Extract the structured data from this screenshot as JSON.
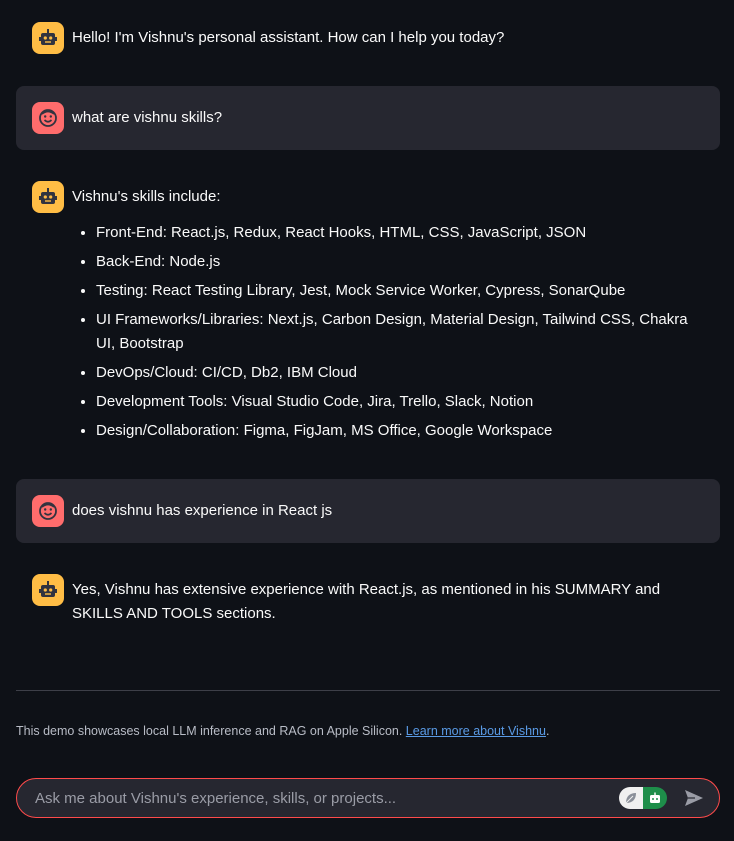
{
  "messages": [
    {
      "role": "assistant",
      "text": "Hello! I'm Vishnu's personal assistant. How can I help you today?"
    },
    {
      "role": "user",
      "text": "what are vishnu skills?"
    },
    {
      "role": "assistant",
      "text": "Vishnu's skills include:",
      "list": [
        "Front-End: React.js, Redux, React Hooks, HTML, CSS, JavaScript, JSON",
        "Back-End: Node.js",
        "Testing: React Testing Library, Jest, Mock Service Worker, Cypress, SonarQube",
        "UI Frameworks/Libraries: Next.js, Carbon Design, Material Design, Tailwind CSS, Chakra UI, Bootstrap",
        "DevOps/Cloud: CI/CD, Db2, IBM Cloud",
        "Development Tools: Visual Studio Code, Jira, Trello, Slack, Notion",
        "Design/Collaboration: Figma, FigJam, MS Office, Google Workspace"
      ]
    },
    {
      "role": "user",
      "text": "does vishnu has experience in React js"
    },
    {
      "role": "assistant",
      "text": "Yes, Vishnu has extensive experience with React.js, as mentioned in his SUMMARY and SKILLS AND TOOLS sections."
    }
  ],
  "footer": {
    "text": "This demo showcases local LLM inference and RAG on Apple Silicon. ",
    "link_text": "Learn more about Vishnu",
    "trailing": "."
  },
  "input": {
    "placeholder": "Ask me about Vishnu's experience, skills, or projects..."
  },
  "colors": {
    "background": "#0e1117",
    "user_bubble": "#262730",
    "bot_avatar": "#ffbd45",
    "user_avatar": "#ff6c6c",
    "input_border": "#ff4b4b",
    "link": "#5a9be6"
  },
  "icons": {
    "assistant_avatar": "robot-face-icon",
    "user_avatar": "smiley-face-icon",
    "send": "send-arrow-icon"
  }
}
